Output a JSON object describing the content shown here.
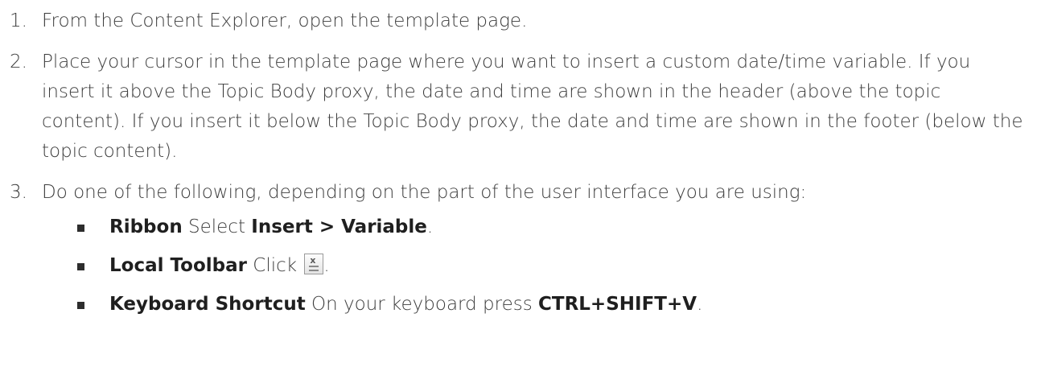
{
  "steps": [
    {
      "num": "1.",
      "text": "From the Content Explorer, open the template page."
    },
    {
      "num": "2.",
      "text": "Place your cursor in the template page where you want to insert a custom date/time variable. If you insert it above the Topic Body proxy, the date and time are shown in the header (above the topic content). If you insert it below the Topic Body proxy, the date and time are shown in the footer (below the topic content)."
    },
    {
      "num": "3.",
      "text": "Do one of the following, depending on the part of the user interface you are using:",
      "options": [
        {
          "label": "Ribbon",
          "text_before": " Select ",
          "bold": "Insert > Variable",
          "text_after": "."
        },
        {
          "label": "Local Toolbar",
          "text_before": " Click ",
          "icon": "insert-variable-icon",
          "text_after": "."
        },
        {
          "label": "Keyboard Shortcut",
          "text_before": " On your keyboard press ",
          "bold": "CTRL+SHIFT+V",
          "text_after": "."
        }
      ]
    }
  ]
}
